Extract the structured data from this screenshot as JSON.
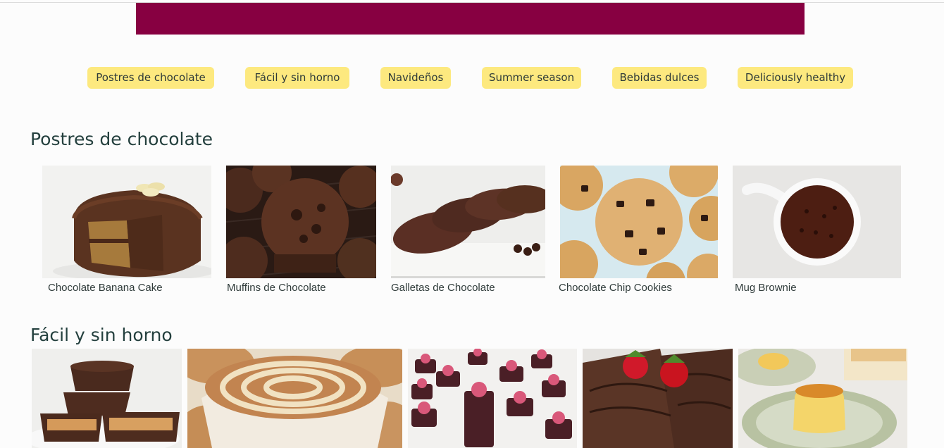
{
  "nav": {
    "items": [
      {
        "label": "Postres de chocolate"
      },
      {
        "label": "Fácil y sin horno"
      },
      {
        "label": "Navideños"
      },
      {
        "label": "Summer season"
      },
      {
        "label": "Bebidas dulces"
      },
      {
        "label": "Deliciously healthy"
      }
    ]
  },
  "sections": [
    {
      "title": "Postres de chocolate",
      "cards": [
        {
          "label": "Chocolate Banana Cake",
          "image": "chocolate-banana-cake-photo"
        },
        {
          "label": "Muffins de Chocolate",
          "image": "chocolate-muffins-photo"
        },
        {
          "label": "Galletas de Chocolate",
          "image": "chocolate-cookies-photo"
        },
        {
          "label": "Chocolate Chip Cookies",
          "image": "chocolate-chip-cookies-photo"
        },
        {
          "label": "Mug Brownie",
          "image": "mug-brownie-photo"
        }
      ]
    },
    {
      "title": "Fácil y sin horno",
      "cards": [
        {
          "label": "",
          "image": "peanut-butter-cups-photo"
        },
        {
          "label": "",
          "image": "cinnamon-roll-cheesecake-photo"
        },
        {
          "label": "",
          "image": "raspberry-chocolate-cups-photo"
        },
        {
          "label": "",
          "image": "chocolate-crepes-strawberries-photo"
        },
        {
          "label": "",
          "image": "flan-photo"
        }
      ]
    }
  ],
  "colors": {
    "banner": "#870041",
    "pill": "#fde97f",
    "background": "#fcfcfc",
    "heading": "#24403e"
  }
}
